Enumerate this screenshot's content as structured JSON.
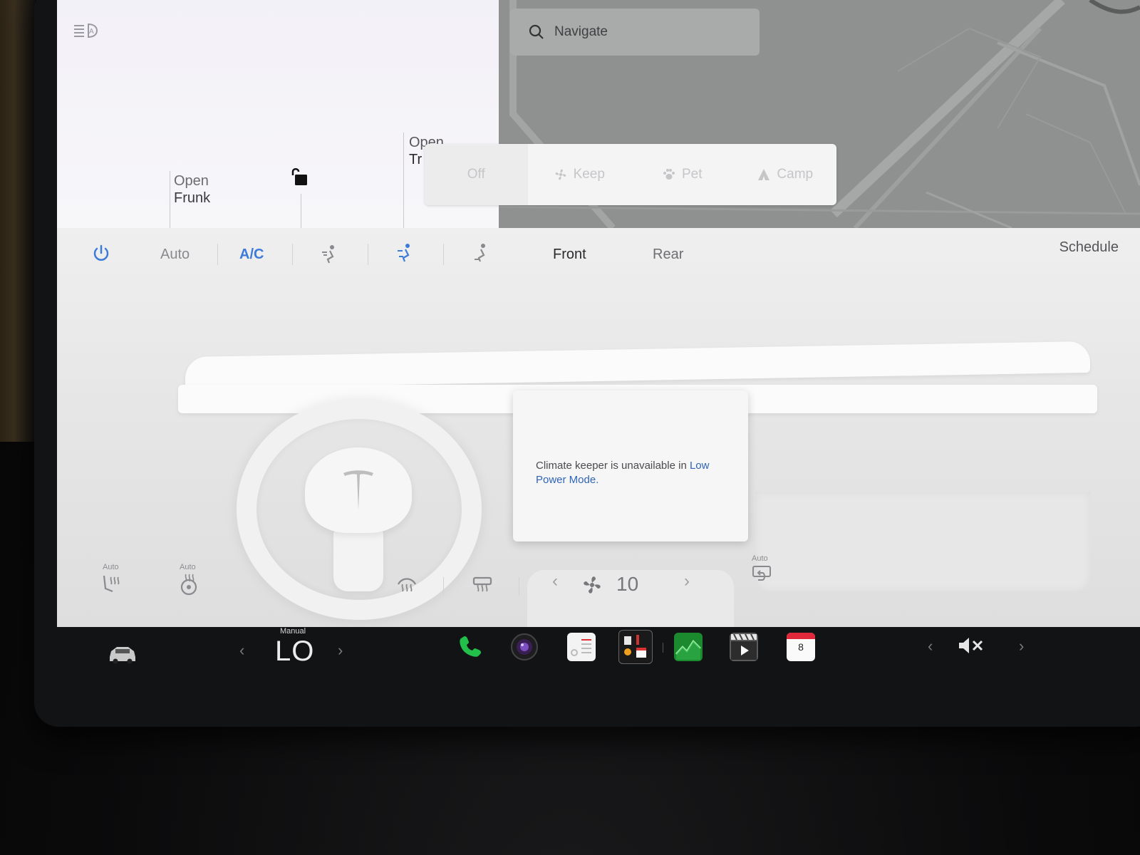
{
  "car_panel": {
    "frunk_line1": "Open",
    "frunk_line2": "Frunk",
    "trunk_line1": "Open",
    "trunk_line2": "Tr"
  },
  "map": {
    "search_label": "Navigate"
  },
  "keep_modes": [
    {
      "label": "Off",
      "icon": "none"
    },
    {
      "label": "Keep",
      "icon": "fan-icon"
    },
    {
      "label": "Pet",
      "icon": "paw-icon"
    },
    {
      "label": "Camp",
      "icon": "tent-icon"
    }
  ],
  "climate_bar": {
    "auto": "Auto",
    "ac": "A/C",
    "front": "Front",
    "rear": "Rear",
    "schedule": "Schedule"
  },
  "keeper_message": {
    "text": "Climate keeper is unavailable in ",
    "link": "Low Power Mode",
    "end": "."
  },
  "bottom_controls": {
    "seat_auto_label": "Auto",
    "wheel_auto_label": "Auto",
    "recirc_auto_label": "Auto",
    "fan_speed": "10"
  },
  "taskbar": {
    "mode_label": "Manual",
    "temperature": "LO",
    "calendar_day": "8"
  },
  "colors": {
    "accent_blue": "#2f64b8",
    "phone_green": "#22c04a"
  }
}
